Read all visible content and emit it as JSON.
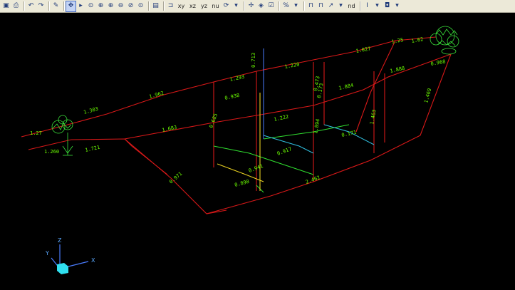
{
  "toolbar": {
    "items": [
      {
        "name": "save-icon",
        "glyph": "▣"
      },
      {
        "name": "print-icon",
        "glyph": "⎙"
      },
      {
        "sep": true
      },
      {
        "name": "undo-icon",
        "glyph": "↶"
      },
      {
        "name": "redo-icon",
        "glyph": "↷"
      },
      {
        "sep": true
      },
      {
        "name": "pencil-icon",
        "glyph": "✎"
      },
      {
        "sep": true
      },
      {
        "name": "pan-icon",
        "glyph": "✥",
        "active": true
      },
      {
        "name": "orbit-icon",
        "glyph": "▸"
      },
      {
        "name": "zoom-realtime-icon",
        "glyph": "⊙"
      },
      {
        "name": "zoom-window-icon",
        "glyph": "⊕"
      },
      {
        "name": "zoom-in-icon",
        "glyph": "⊕"
      },
      {
        "name": "zoom-out-icon",
        "glyph": "⊖"
      },
      {
        "name": "zoom-extents-icon",
        "glyph": "⊘"
      },
      {
        "name": "zoom-previous-icon",
        "glyph": "⊙"
      },
      {
        "sep": true
      },
      {
        "name": "named-views-icon",
        "glyph": "▤"
      },
      {
        "sep": true
      },
      {
        "name": "view-top-icon",
        "glyph": "⊐"
      },
      {
        "name": "view-xy-icon",
        "text": "xy"
      },
      {
        "name": "view-xz-icon",
        "text": "xz"
      },
      {
        "name": "view-yz-icon",
        "text": "yz"
      },
      {
        "name": "view-nu-icon",
        "text": "nu"
      },
      {
        "name": "rotate-view-icon",
        "glyph": "⟳"
      },
      {
        "name": "view-dropdown-icon",
        "glyph": "▾"
      },
      {
        "sep": true
      },
      {
        "name": "move-icon",
        "glyph": "✢"
      },
      {
        "name": "shade-icon",
        "glyph": "◈"
      },
      {
        "name": "check-icon",
        "glyph": "☑"
      },
      {
        "sep": true
      },
      {
        "name": "percent-icon",
        "glyph": "%"
      },
      {
        "name": "percent-dropdown-icon",
        "glyph": "▾"
      },
      {
        "sep": true
      },
      {
        "name": "dimension-icon",
        "glyph": "⊓"
      },
      {
        "name": "level-icon",
        "glyph": "⊓"
      },
      {
        "name": "elevation-icon",
        "glyph": "↗"
      },
      {
        "name": "elevation-dropdown-icon",
        "glyph": "▾"
      },
      {
        "name": "nd-icon",
        "text": "nd"
      },
      {
        "sep": true
      },
      {
        "name": "text-cursor-icon",
        "glyph": "I"
      },
      {
        "name": "text-dropdown-icon",
        "glyph": "▾"
      },
      {
        "name": "layers-icon",
        "glyph": "◘"
      },
      {
        "name": "layers-dropdown-icon",
        "glyph": "▾"
      }
    ]
  },
  "colors": {
    "background": "#000000",
    "pipe_red": "#d81818",
    "pipe_green": "#30e030",
    "pipe_yellow": "#e8d020",
    "pipe_cyan": "#30c0e0",
    "pipe_blue": "#4a7cff",
    "label_green": "#6cff00",
    "symbol_green": "#3ae03a"
  },
  "ucs": {
    "x_label": "X",
    "y_label": "Y",
    "z_label": "Z"
  },
  "labels": [
    {
      "id": "l1",
      "text": "1.27"
    },
    {
      "id": "l2",
      "text": "1.260"
    },
    {
      "id": "l3",
      "text": "1.721"
    },
    {
      "id": "l4",
      "text": "1.303"
    },
    {
      "id": "l5",
      "text": "1.962"
    },
    {
      "id": "l6",
      "text": "1.293"
    },
    {
      "id": "l7",
      "text": "1.220"
    },
    {
      "id": "l8",
      "text": "1.027"
    },
    {
      "id": "l9",
      "text": "1.62"
    },
    {
      "id": "l10",
      "text": "1.25"
    },
    {
      "id": "l11",
      "text": "0.968"
    },
    {
      "id": "l12",
      "text": "0.938"
    },
    {
      "id": "l13",
      "text": "1.683"
    },
    {
      "id": "l14",
      "text": "1.222"
    },
    {
      "id": "l15",
      "text": "0.685"
    },
    {
      "id": "l16",
      "text": "0.173"
    },
    {
      "id": "l17",
      "text": "1.884"
    },
    {
      "id": "l18",
      "text": "1.888"
    },
    {
      "id": "l19",
      "text": "0.171"
    },
    {
      "id": "l20",
      "text": "2.462"
    },
    {
      "id": "l21",
      "text": "0.917"
    },
    {
      "id": "l22",
      "text": "0.898"
    },
    {
      "id": "l23",
      "text": "1.894"
    },
    {
      "id": "l24",
      "text": "1.463"
    },
    {
      "id": "l25",
      "text": "0.971"
    },
    {
      "id": "l26",
      "text": "0.473"
    },
    {
      "id": "l27",
      "text": "0.713"
    },
    {
      "id": "l28",
      "text": "0.941"
    },
    {
      "id": "l29",
      "text": "1.469"
    }
  ]
}
